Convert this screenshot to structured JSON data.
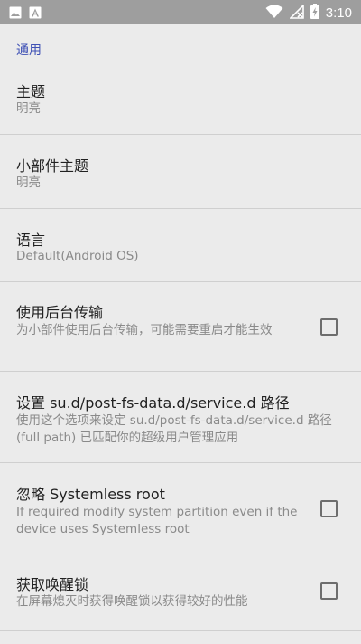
{
  "status_bar": {
    "time": "3:10",
    "icons": [
      "image-icon",
      "a-icon",
      "wifi-icon",
      "no-signal-icon",
      "battery-charging-icon"
    ]
  },
  "section": {
    "label": "通用"
  },
  "prefs": {
    "theme": {
      "title": "主题",
      "summary": "明亮"
    },
    "widget_theme": {
      "title": "小部件主题",
      "summary": "明亮"
    },
    "language": {
      "title": "语言",
      "summary": "Default(Android OS)"
    },
    "background_transfer": {
      "title": "使用后台传输",
      "summary": "为小部件使用后台传输，可能需要重启才能生效",
      "checked": false
    },
    "su_path": {
      "title": "设置 su.d/post-fs-data.d/service.d 路径",
      "summary": "使用这个选项来设定 su.d/post-fs-data.d/service.d 路径 (full path) 已匹配你的超级用户管理应用"
    },
    "ignore_systemless": {
      "title": "忽略 Systemless root",
      "summary": "If required modify system partition even if the device uses Systemless root",
      "checked": false
    },
    "wakelock": {
      "title": "获取唤醒锁",
      "summary": "在屏幕熄灭时获得唤醒锁以获得较好的性能",
      "checked": false
    }
  }
}
